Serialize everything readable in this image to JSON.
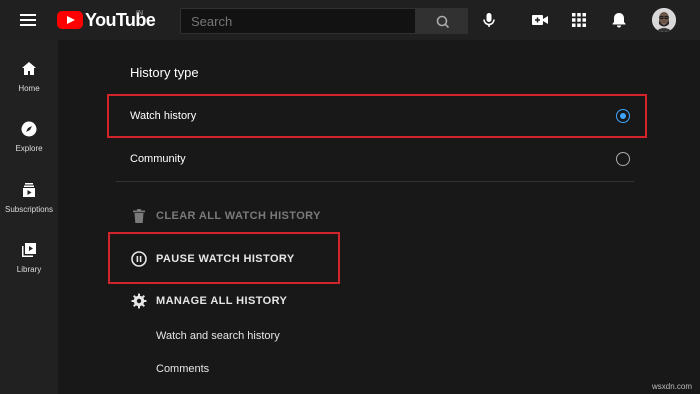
{
  "header": {
    "logo_text": "YouTube",
    "region": "IN",
    "search_placeholder": "Search"
  },
  "sidebar": {
    "items": [
      {
        "label": "Home"
      },
      {
        "label": "Explore"
      },
      {
        "label": "Subscriptions"
      },
      {
        "label": "Library"
      }
    ]
  },
  "history": {
    "section_title": "History type",
    "options": [
      {
        "label": "Watch history",
        "selected": true
      },
      {
        "label": "Community",
        "selected": false
      }
    ],
    "actions": {
      "clear": "CLEAR ALL WATCH HISTORY",
      "pause": "PAUSE WATCH HISTORY",
      "manage": "MANAGE ALL HISTORY"
    },
    "links": [
      "Watch and search history",
      "Comments"
    ]
  },
  "colors": {
    "accent": "#3ea6ff",
    "highlight": "#d3242b",
    "brand": "#ff0000"
  },
  "watermark": "wsxdn.com"
}
